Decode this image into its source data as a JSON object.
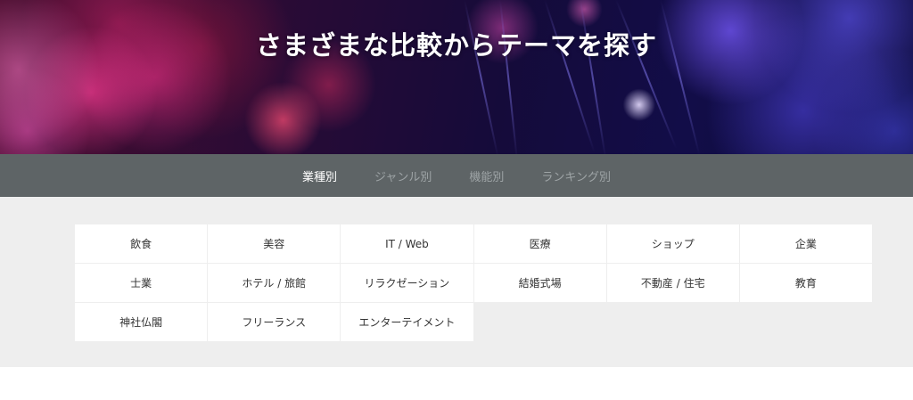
{
  "hero": {
    "title": "さまざまな比較からテーマを探す"
  },
  "tabs": [
    {
      "label": "業種別",
      "active": true
    },
    {
      "label": "ジャンル別",
      "active": false
    },
    {
      "label": "機能別",
      "active": false
    },
    {
      "label": "ランキング別",
      "active": false
    }
  ],
  "categories": [
    {
      "label": "飲食"
    },
    {
      "label": "美容"
    },
    {
      "label": "IT / Web"
    },
    {
      "label": "医療"
    },
    {
      "label": "ショップ"
    },
    {
      "label": "企業"
    },
    {
      "label": "士業"
    },
    {
      "label": "ホテル / 旅館"
    },
    {
      "label": "リラクゼーション"
    },
    {
      "label": "結婚式場"
    },
    {
      "label": "不動産 / 住宅"
    },
    {
      "label": "教育"
    },
    {
      "label": "神社仏閣"
    },
    {
      "label": "フリーランス"
    },
    {
      "label": "エンターテイメント"
    }
  ],
  "colors": {
    "tab_bar": "#5e6466",
    "tab_active": "#ffffff",
    "tab_inactive": "#9ea4a6",
    "panel_bg": "#eeeeee",
    "cell_bg": "#ffffff"
  }
}
